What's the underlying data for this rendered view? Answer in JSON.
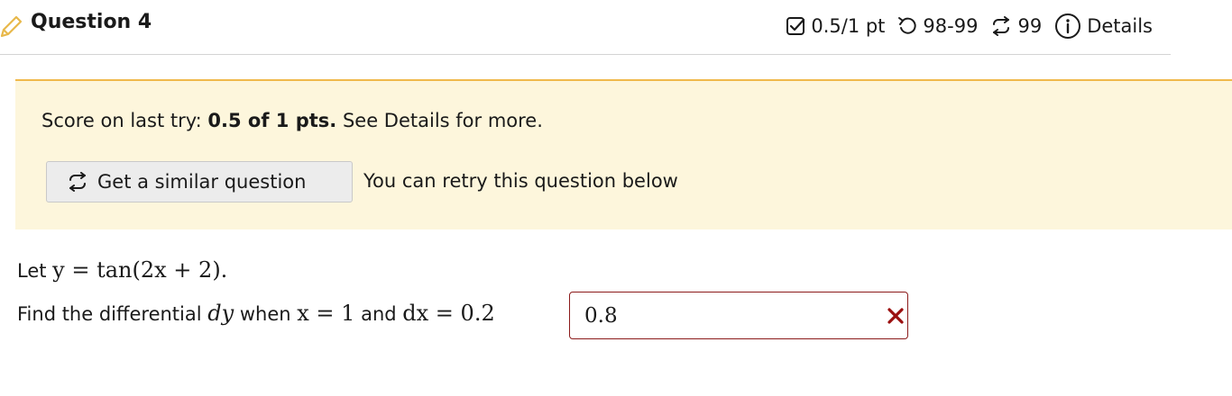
{
  "header": {
    "title": "Question 4",
    "score": "0.5/1 pt",
    "attempts": "98-99",
    "retries": "99",
    "details_label": "Details"
  },
  "notice": {
    "score_prefix": "Score on last try: ",
    "score_value": "0.5 of 1 pts.",
    "score_suffix": " See Details for more.",
    "similar_button_label": "Get a similar question",
    "retry_text": "You can retry this question below"
  },
  "question": {
    "let_prefix": "Let ",
    "let_math": "y = tan(2x + 2).",
    "find_prefix": "Find the differential ",
    "find_dy": "dy",
    "when_text": " when ",
    "x_condition": "x = 1",
    "and_text": " and ",
    "dx_condition": "dx = 0.2"
  },
  "answer": {
    "value": "0.8",
    "status": "incorrect"
  },
  "colors": {
    "notice_bg": "#fdf6dc",
    "notice_border": "#f0b94c",
    "error": "#8b1a1a",
    "pencil": "#e8b84a"
  },
  "icons": {
    "pencil": "pencil-icon",
    "score": "checkbox-icon",
    "attempts": "undo-icon",
    "retries": "repeat-icon",
    "details": "info-icon",
    "incorrect": "x-mark-icon"
  }
}
